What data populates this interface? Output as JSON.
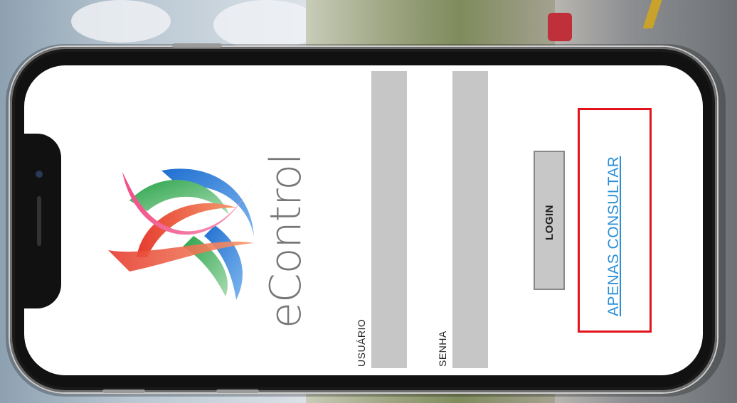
{
  "app": {
    "brand": "eControl"
  },
  "form": {
    "username_label": "USUÁRIO",
    "username_value": "",
    "password_label": "SENHA",
    "password_value": ""
  },
  "actions": {
    "login_label": "LOGIN",
    "consult_link_label": "APENAS CONSULTAR"
  },
  "colors": {
    "link": "#2c8fd6",
    "highlight_box": "#e2141b",
    "field_background": "#c6c6c6",
    "button_background": "#c7c7c7"
  },
  "icons": {
    "logo": "econtrol-logo-icon"
  }
}
